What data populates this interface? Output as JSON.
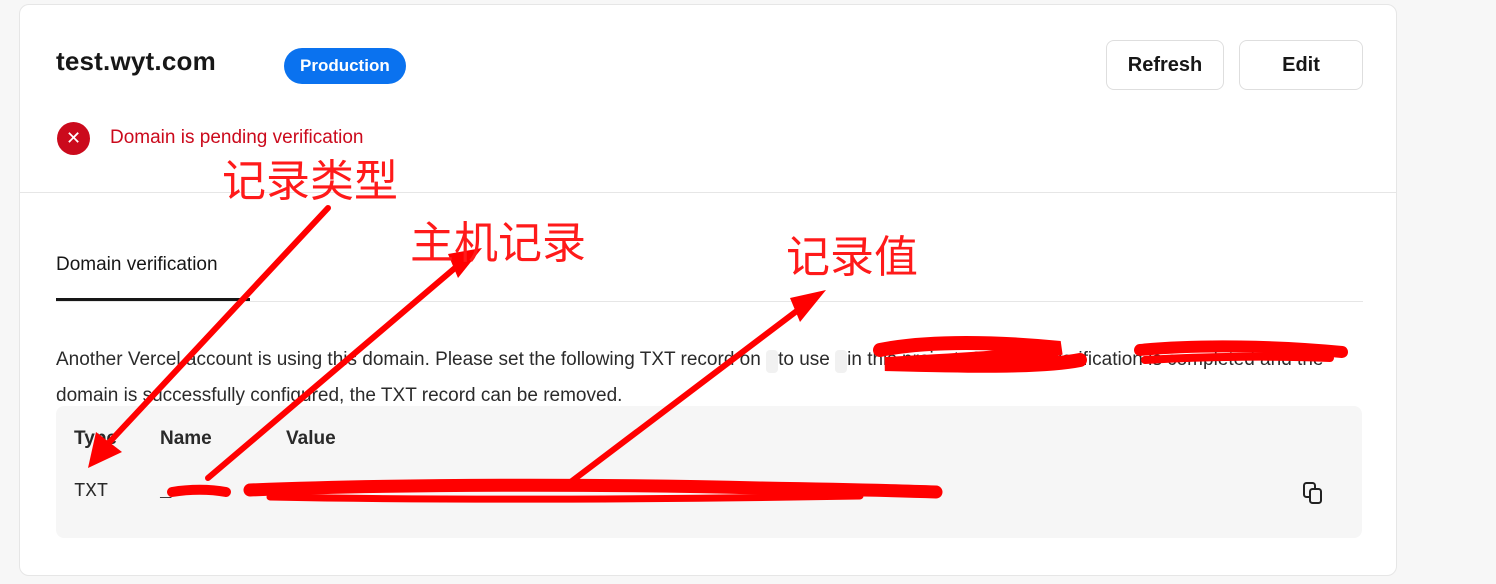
{
  "header": {
    "domain": "test.wyt.com",
    "environment_badge": "Production",
    "refresh_label": "Refresh",
    "edit_label": "Edit"
  },
  "status": {
    "icon": "close-icon",
    "text": "Domain is pending verification",
    "color": "#cb0a1c"
  },
  "tabs": [
    {
      "label": "Domain verification",
      "active": true
    }
  ],
  "description": {
    "part1": "Another Vercel account is using this domain. Please set the following TXT record on ",
    "part2": " to use ",
    "part3": " in this project. Once the verification is completed and the domain is successfully configured, the TXT record can be removed."
  },
  "records": {
    "headers": {
      "type": "Type",
      "name": "Name",
      "value": "Value"
    },
    "rows": [
      {
        "type": "TXT",
        "name": "_",
        "value": ""
      }
    ],
    "copy_icon": "copy-icon"
  },
  "annotations": {
    "record_type": "记录类型",
    "host_record": "主机记录",
    "record_value": "记录值",
    "color": "#ff1a1a"
  },
  "colors": {
    "accent": "#0a72ef",
    "error": "#cb0a1c",
    "annotation": "#ff1a1a"
  }
}
